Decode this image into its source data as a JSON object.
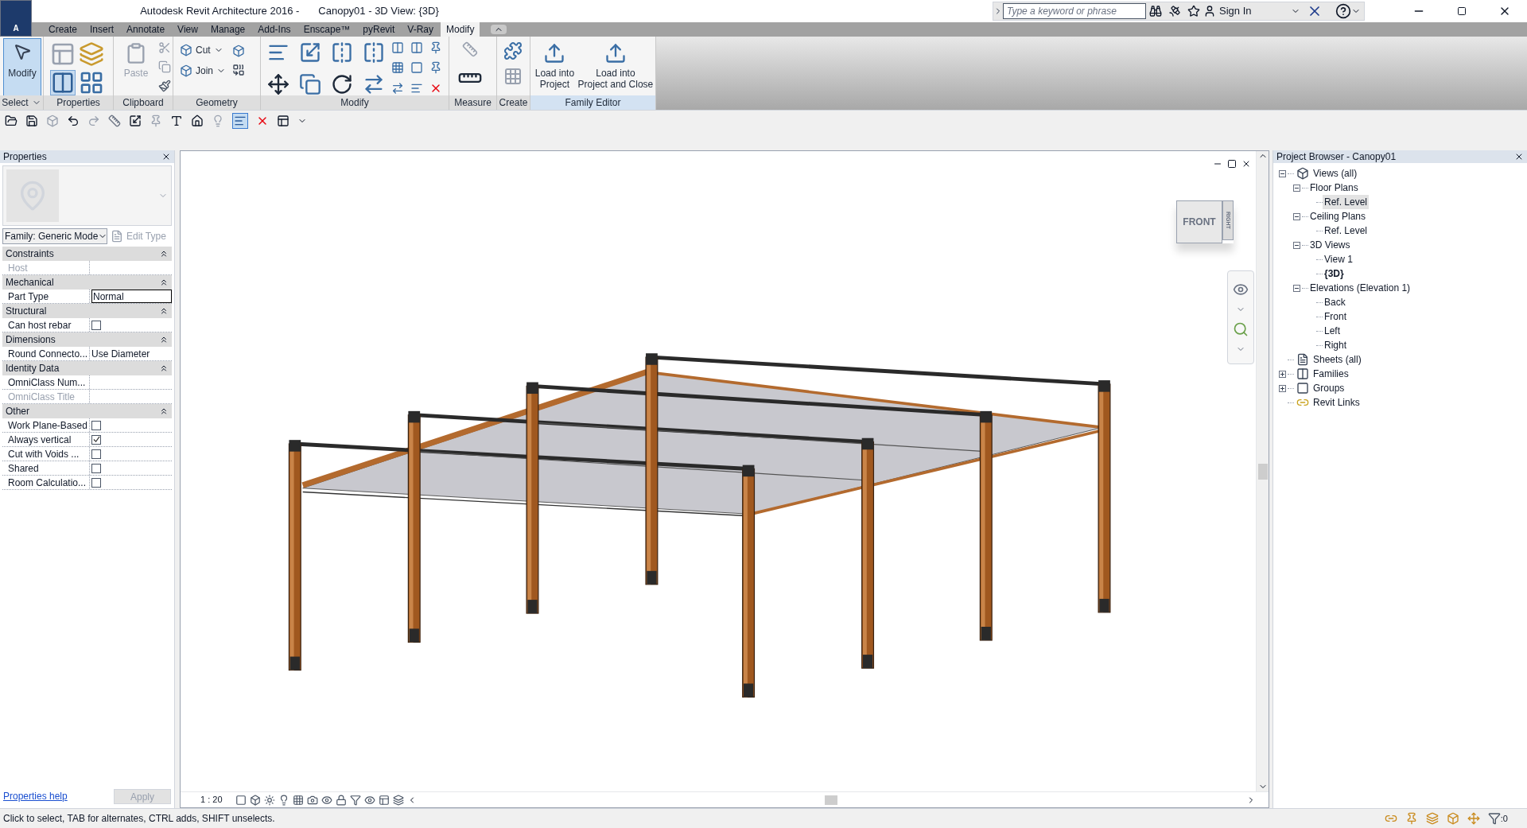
{
  "app_menu": {
    "letter": "A"
  },
  "window": {
    "app_title": "Autodesk Revit Architecture 2016 -",
    "document_title": "Canopy01 - 3D View: {3D}"
  },
  "search": {
    "placeholder": "Type a keyword or phrase"
  },
  "sign_in": "Sign In",
  "tabs": [
    {
      "label": "Create",
      "selected": false
    },
    {
      "label": "Insert",
      "selected": false
    },
    {
      "label": "Annotate",
      "selected": false
    },
    {
      "label": "View",
      "selected": false
    },
    {
      "label": "Manage",
      "selected": false
    },
    {
      "label": "Add-Ins",
      "selected": false
    },
    {
      "label": "Enscape™",
      "selected": false
    },
    {
      "label": "pyRevit",
      "selected": false
    },
    {
      "label": "V-Ray",
      "selected": false
    },
    {
      "label": "Modify",
      "selected": true
    }
  ],
  "ribbon_panels": [
    {
      "label": "Select",
      "has_menu": true,
      "tools": [
        {
          "kind": "large",
          "label_lines": [
            "Modify"
          ],
          "selected": true,
          "disabled": false
        }
      ]
    },
    {
      "label": "Properties"
    },
    {
      "label": "Clipboard",
      "tools": [
        {
          "kind": "large",
          "label_lines": [
            "Paste"
          ],
          "disabled": true
        }
      ]
    },
    {
      "label": "Geometry",
      "tools": [
        {
          "kind": "small",
          "label_lines": [
            "Cut"
          ],
          "disabled": false
        },
        {
          "kind": "small",
          "label_lines": [
            "Join"
          ],
          "disabled": false
        }
      ]
    },
    {
      "label": "Modify"
    },
    {
      "label": "Measure"
    },
    {
      "label": "Create"
    },
    {
      "label": "Family Editor",
      "tools": [
        {
          "kind": "large",
          "label_lines": [
            "Load into",
            "Project"
          ],
          "disabled": false
        },
        {
          "kind": "large",
          "label_lines": [
            "Load into",
            "Project and Close"
          ],
          "disabled": false
        }
      ]
    }
  ],
  "quick_access": {
    "thin_lines": {
      "on": true
    }
  },
  "properties": {
    "title": "Properties",
    "type_selector": "Family: Generic Mode",
    "edit_type": {
      "label": "Edit Type",
      "disabled": true
    },
    "groups": [
      {
        "name": "Constraints",
        "expanded": true,
        "rows": [
          {
            "label": "Host",
            "kind": "text",
            "disabled": true
          }
        ]
      },
      {
        "name": "Mechanical",
        "expanded": true,
        "rows": [
          {
            "label": "Part Type",
            "kind": "field",
            "value": "Normal",
            "disabled": false
          }
        ]
      },
      {
        "name": "Structural",
        "expanded": true,
        "rows": [
          {
            "label": "Can host rebar",
            "kind": "checkbox",
            "checked": false,
            "disabled": false
          }
        ]
      },
      {
        "name": "Dimensions",
        "expanded": true,
        "rows": [
          {
            "label": "Round Connecto...",
            "kind": "text",
            "value": "Use Diameter",
            "disabled": false
          }
        ]
      },
      {
        "name": "Identity Data",
        "expanded": true,
        "rows": [
          {
            "label": "OmniClass Num...",
            "kind": "text",
            "disabled": false
          },
          {
            "label": "OmniClass Title",
            "kind": "text",
            "disabled": true
          }
        ]
      },
      {
        "name": "Other",
        "expanded": true,
        "rows": [
          {
            "label": "Work Plane-Based",
            "kind": "checkbox",
            "checked": false,
            "disabled": false
          },
          {
            "label": "Always vertical",
            "kind": "checkbox",
            "checked": true,
            "disabled": false
          },
          {
            "label": "Cut with Voids ...",
            "kind": "checkbox",
            "checked": false,
            "disabled": false
          },
          {
            "label": "Shared",
            "kind": "checkbox",
            "checked": false,
            "disabled": false
          },
          {
            "label": "Room Calculatio...",
            "kind": "checkbox",
            "checked": false,
            "disabled": false
          }
        ]
      }
    ],
    "help_link": "Properties help",
    "apply": {
      "label": "Apply",
      "disabled": true
    }
  },
  "view": {
    "cube_front": "FRONT",
    "cube_side": "RIGHT",
    "scale": "1 : 20"
  },
  "project_browser": {
    "title": "Project Browser - Canopy01",
    "tree": [
      {
        "label": "Views (all)",
        "expanded": true,
        "selected": false,
        "current": false,
        "children": [
          {
            "label": "Floor Plans",
            "expanded": true,
            "selected": false,
            "current": false,
            "children": [
              {
                "label": "Ref. Level",
                "selected": true,
                "current": false
              }
            ]
          },
          {
            "label": "Ceiling Plans",
            "expanded": true,
            "selected": false,
            "current": false,
            "children": [
              {
                "label": "Ref. Level",
                "selected": false,
                "current": false
              }
            ]
          },
          {
            "label": "3D Views",
            "expanded": true,
            "selected": false,
            "current": false,
            "children": [
              {
                "label": "View 1",
                "selected": false,
                "current": false
              },
              {
                "label": "{3D}",
                "selected": false,
                "current": true
              }
            ]
          },
          {
            "label": "Elevations (Elevation 1)",
            "expanded": true,
            "selected": false,
            "current": false,
            "children": [
              {
                "label": "Back",
                "selected": false,
                "current": false
              },
              {
                "label": "Front",
                "selected": false,
                "current": false
              },
              {
                "label": "Left",
                "selected": false,
                "current": false
              },
              {
                "label": "Right",
                "selected": false,
                "current": false
              }
            ]
          }
        ]
      },
      {
        "label": "Sheets (all)",
        "selected": false,
        "current": false
      },
      {
        "label": "Families",
        "expanded": false,
        "selected": false,
        "current": false
      },
      {
        "label": "Groups",
        "expanded": false,
        "selected": false,
        "current": false
      },
      {
        "label": "Revit Links",
        "selected": false,
        "current": false
      }
    ]
  },
  "status_bar": {
    "message": "Click to select, TAB for alternates, CTRL adds, SHIFT unselects.",
    "filter_count": ":0"
  }
}
